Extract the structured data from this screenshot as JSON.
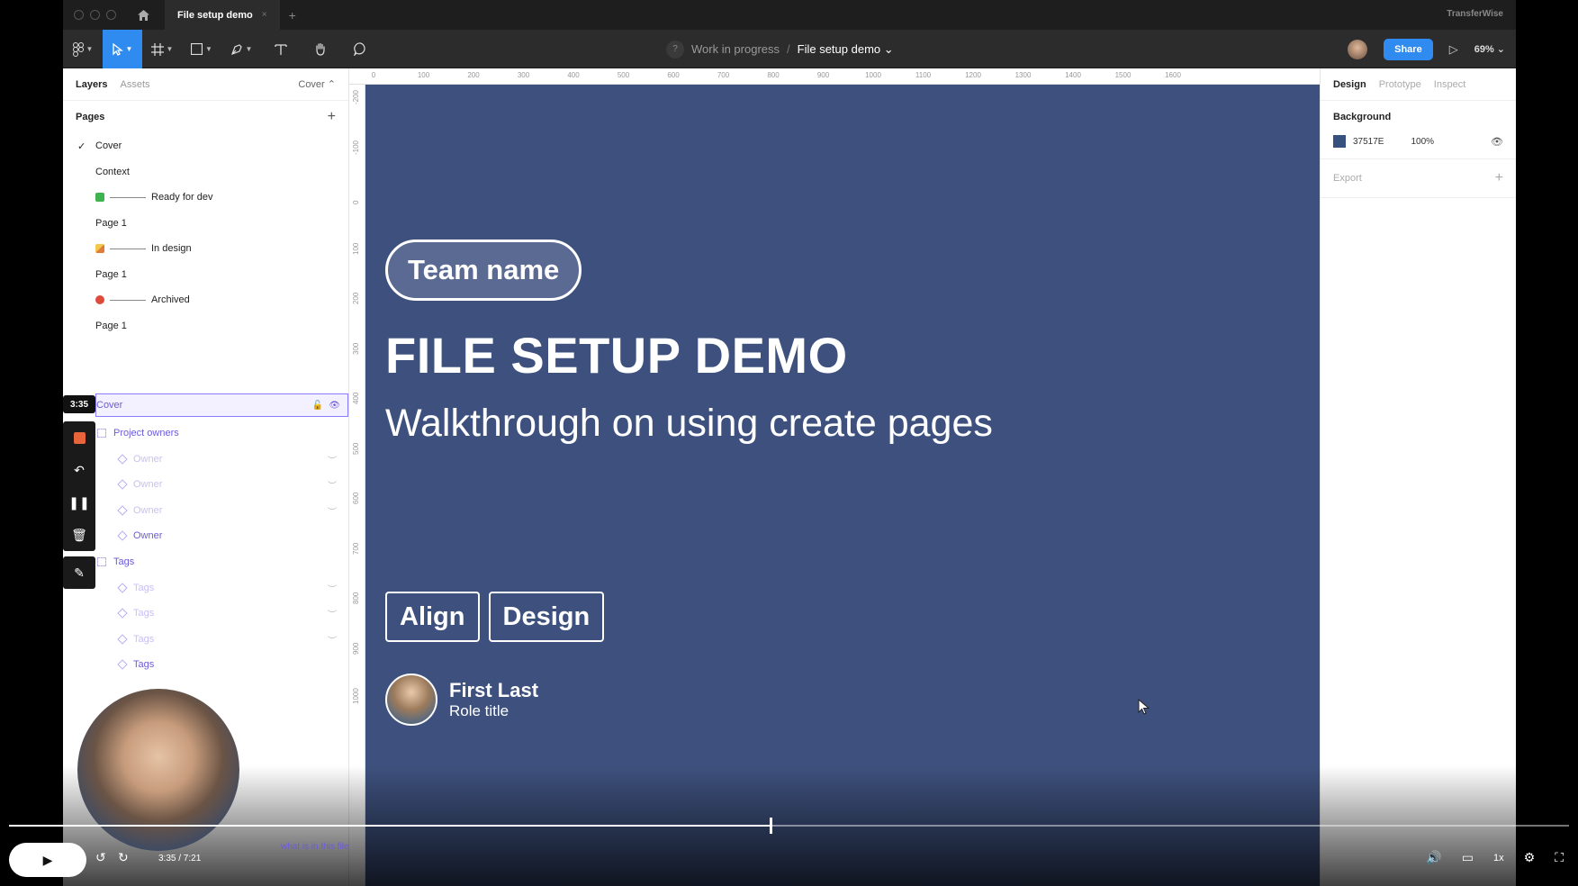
{
  "titlebar": {
    "tab_title": "File setup demo",
    "tab_close": "×",
    "new_tab": "+",
    "brand": "TransferWise"
  },
  "toolbar": {
    "breadcrumb_parent": "Work in progress",
    "breadcrumb_sep": "/",
    "breadcrumb_current": "File setup demo ⌄",
    "crumb_avatar": "?",
    "share_label": "Share",
    "zoom": "69% ⌄"
  },
  "left_panel": {
    "tabs": [
      "Layers",
      "Assets"
    ],
    "page_selector": "Cover ⌃",
    "pages_heading": "Pages",
    "pages": [
      {
        "label": "Cover",
        "checked": true
      },
      {
        "label": "Context"
      },
      {
        "label": "Ready for dev",
        "emoji": "green-check"
      },
      {
        "label": "Page 1"
      },
      {
        "label": "In design",
        "emoji": "pencil"
      },
      {
        "label": "Page 1"
      },
      {
        "label": "Archived",
        "emoji": "red-circle"
      },
      {
        "label": "Page 1"
      }
    ],
    "selected_layer": "Cover",
    "layers": [
      {
        "label": "Project owners",
        "kind": "frame",
        "indent": 1
      },
      {
        "label": "Owner",
        "kind": "component",
        "indent": 2,
        "faded": true
      },
      {
        "label": "Owner",
        "kind": "component",
        "indent": 2,
        "faded": true
      },
      {
        "label": "Owner",
        "kind": "component",
        "indent": 2,
        "faded": true
      },
      {
        "label": "Owner",
        "kind": "component",
        "indent": 2
      },
      {
        "label": "Tags",
        "kind": "frame",
        "indent": 1
      },
      {
        "label": "Tags",
        "kind": "component",
        "indent": 2,
        "faded": true
      },
      {
        "label": "Tags",
        "kind": "component",
        "indent": 2,
        "faded": true
      },
      {
        "label": "Tags",
        "kind": "component",
        "indent": 2,
        "faded": true
      },
      {
        "label": "Tags",
        "kind": "component",
        "indent": 2
      }
    ],
    "bottom_hint": "what is in this file"
  },
  "recorder": {
    "elapsed": "3:35"
  },
  "canvas": {
    "ruler_top": [
      "0",
      "100",
      "200",
      "300",
      "400",
      "500",
      "600",
      "700",
      "800",
      "900",
      "1000",
      "1100",
      "1200",
      "1300",
      "1400",
      "1500",
      "1600"
    ],
    "ruler_left": [
      "-200",
      "-100",
      "0",
      "100",
      "200",
      "300",
      "400",
      "500",
      "600",
      "700",
      "800",
      "900",
      "1000"
    ],
    "frame_color": "#3E517E",
    "team_name": "Team name",
    "title": "FILE SETUP DEMO",
    "subtitle": "Walkthrough on using create pages",
    "tags": [
      "Align",
      "Design"
    ],
    "person_name": "First Last",
    "person_role": "Role title"
  },
  "right_panel": {
    "tabs": [
      "Design",
      "Prototype",
      "Inspect"
    ],
    "background_label": "Background",
    "background_hex": "37517E",
    "background_opacity": "100%",
    "export_label": "Export"
  },
  "video": {
    "time": "3:35 / 7:21",
    "progress": 0.488,
    "speed": "1x"
  },
  "colors": {
    "accent": "#2F8BF0",
    "selection": "#8B7BFF",
    "frame_bg": "#3E517E"
  }
}
